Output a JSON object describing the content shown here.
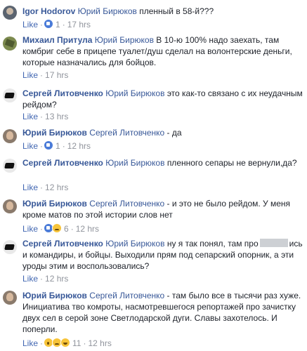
{
  "labels": {
    "like": "Like",
    "dot": "·"
  },
  "comments": [
    {
      "author": "Igor Hodorov",
      "tag": "Юрий Бирюков",
      "text": "пленный в 58-й???",
      "reactions": [
        "like"
      ],
      "count": "1",
      "time": "17 hrs"
    },
    {
      "author": "Михаил Притула",
      "tag": "Юрий Бирюков",
      "text": "В 10-ю 100% надо заехать, там комбриг себе в прицепе туалет/душ сделал на волонтерские деньги, которые назначались для бойцов.",
      "time": "17 hrs"
    },
    {
      "author": "Сергей Литовченко",
      "tag": "Юрий Бирюков",
      "text": "это как-то связано с их неудачным рейдом?",
      "time": "13 hrs"
    },
    {
      "author": "Юрий Бирюков",
      "tag": "Сергей Литовченко",
      "text": "- да",
      "reactions": [
        "like"
      ],
      "count": "1",
      "time": "12 hrs"
    },
    {
      "author": "Сергей Литовченко",
      "tag": "Юрий Бирюков",
      "text": "пленного сепары не вернули,да?",
      "time": "12 hrs"
    },
    {
      "author": "Юрий Бирюков",
      "tag": "Сергей Литовченко",
      "text": "- и это не было рейдом. У меня кроме матов по этой истории слов нет",
      "reactions": [
        "like",
        "sad"
      ],
      "count": "6",
      "time": "12 hrs"
    },
    {
      "author": "Сергей Литовченко",
      "tag": "Юрий Бирюков",
      "text_before": "ну я так понял, там про",
      "text_after": "ись и командиры, и бойцы. Выходили прям под сепарский опорник, а эти уроды этим и воспользовались?",
      "time": "12 hrs"
    },
    {
      "author": "Юрий Бирюков",
      "tag": "Сергей Литовченко",
      "text": "- там было все в тысячи раз хуже. Инициатива тво комроты, насмотревшегося репортажей про зачистку двух сел в серой зоне Светлодарской дуги. Славы захотелось. И поперли.",
      "reactions": [
        "wow",
        "sad",
        "haha"
      ],
      "count": "11",
      "time": "12 hrs"
    }
  ]
}
